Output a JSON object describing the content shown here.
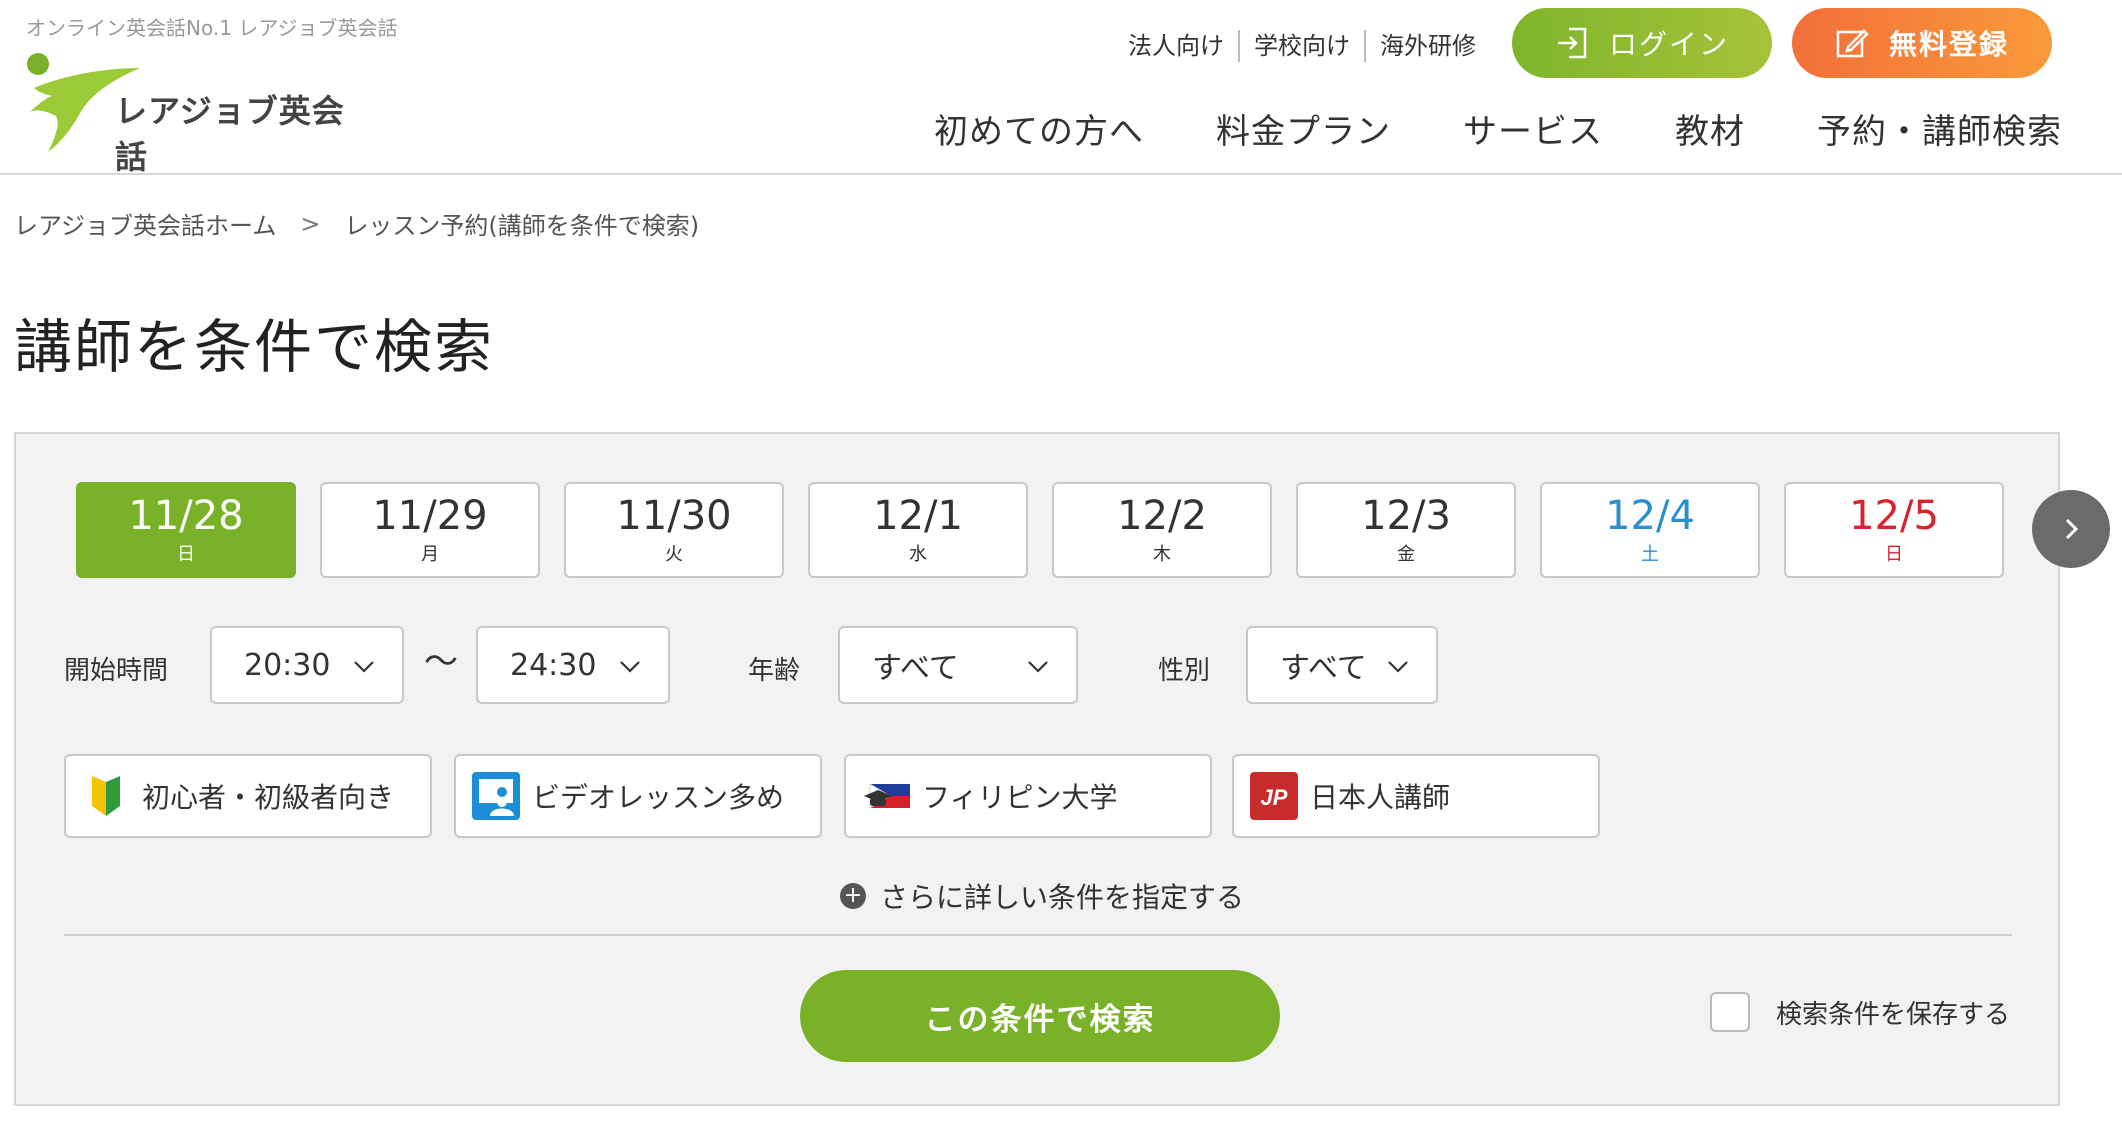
{
  "header": {
    "tagline": "オンライン英会話No.1 レアジョブ英会話",
    "logo_text": "レアジョブ英会話",
    "util_links": [
      "法人向け",
      "学校向け",
      "海外研修"
    ],
    "login_label": "ログイン",
    "register_label": "無料登録",
    "nav": [
      "初めての方へ",
      "料金プラン",
      "サービス",
      "教材",
      "予約・講師検索"
    ]
  },
  "breadcrumb": {
    "home": "レアジョブ英会話ホーム",
    "separator": ">",
    "current": "レッスン予約(講師を条件で検索)"
  },
  "page_title": "講師を条件で検索",
  "dates": [
    {
      "date": "11/28",
      "weekday": "日",
      "state": "active"
    },
    {
      "date": "11/29",
      "weekday": "月",
      "state": "normal"
    },
    {
      "date": "11/30",
      "weekday": "火",
      "state": "normal"
    },
    {
      "date": "12/1",
      "weekday": "水",
      "state": "normal"
    },
    {
      "date": "12/2",
      "weekday": "木",
      "state": "normal"
    },
    {
      "date": "12/3",
      "weekday": "金",
      "state": "normal"
    },
    {
      "date": "12/4",
      "weekday": "土",
      "state": "sat"
    },
    {
      "date": "12/5",
      "weekday": "日",
      "state": "sun"
    }
  ],
  "filters": {
    "start_time_label": "開始時間",
    "start_time_from": "20:30",
    "tilde": "〜",
    "start_time_to": "24:30",
    "age_label": "年齢",
    "age_value": "すべて",
    "gender_label": "性別",
    "gender_value": "すべて"
  },
  "categories": [
    {
      "label": "初心者・初級者向き",
      "icon": "beginner-mark-icon"
    },
    {
      "label": "ビデオレッスン多め",
      "icon": "video-lesson-icon"
    },
    {
      "label": "フィリピン大学",
      "icon": "philippine-university-icon"
    },
    {
      "label": "日本人講師",
      "icon": "japanese-teacher-icon"
    }
  ],
  "jp_badge": "JP",
  "more_conditions": "さらに詳しい条件を指定する",
  "search_button": "この条件で検索",
  "save_conditions": "検索条件を保存する",
  "colors": {
    "green": "#79b228",
    "orange": "#f5803a",
    "saturday": "#2a8fcf",
    "sunday": "#d7232d"
  }
}
